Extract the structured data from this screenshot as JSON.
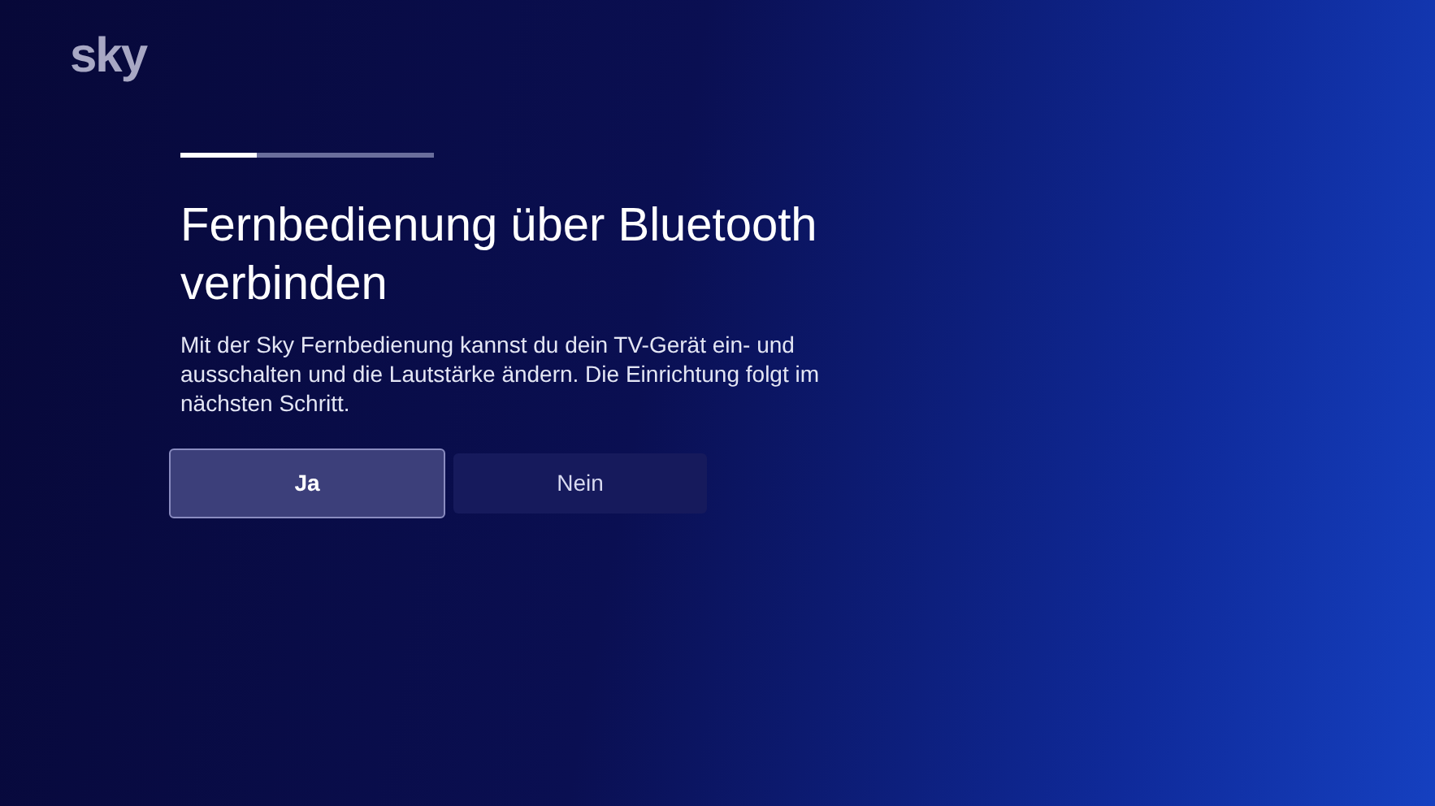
{
  "logo": "sky",
  "progress": {
    "level": 0.3
  },
  "title": "Fernbedienung über Bluetooth verbinden",
  "description": "Mit der Sky Fernbedienung kannst du dein TV-Gerät ein- und ausschalten und die Lautstärke ändern. Die Einrichtung folgt im nächsten Schritt.",
  "buttons": [
    {
      "label": "Ja",
      "selected": true
    },
    {
      "label": "Nein",
      "selected": false
    }
  ]
}
